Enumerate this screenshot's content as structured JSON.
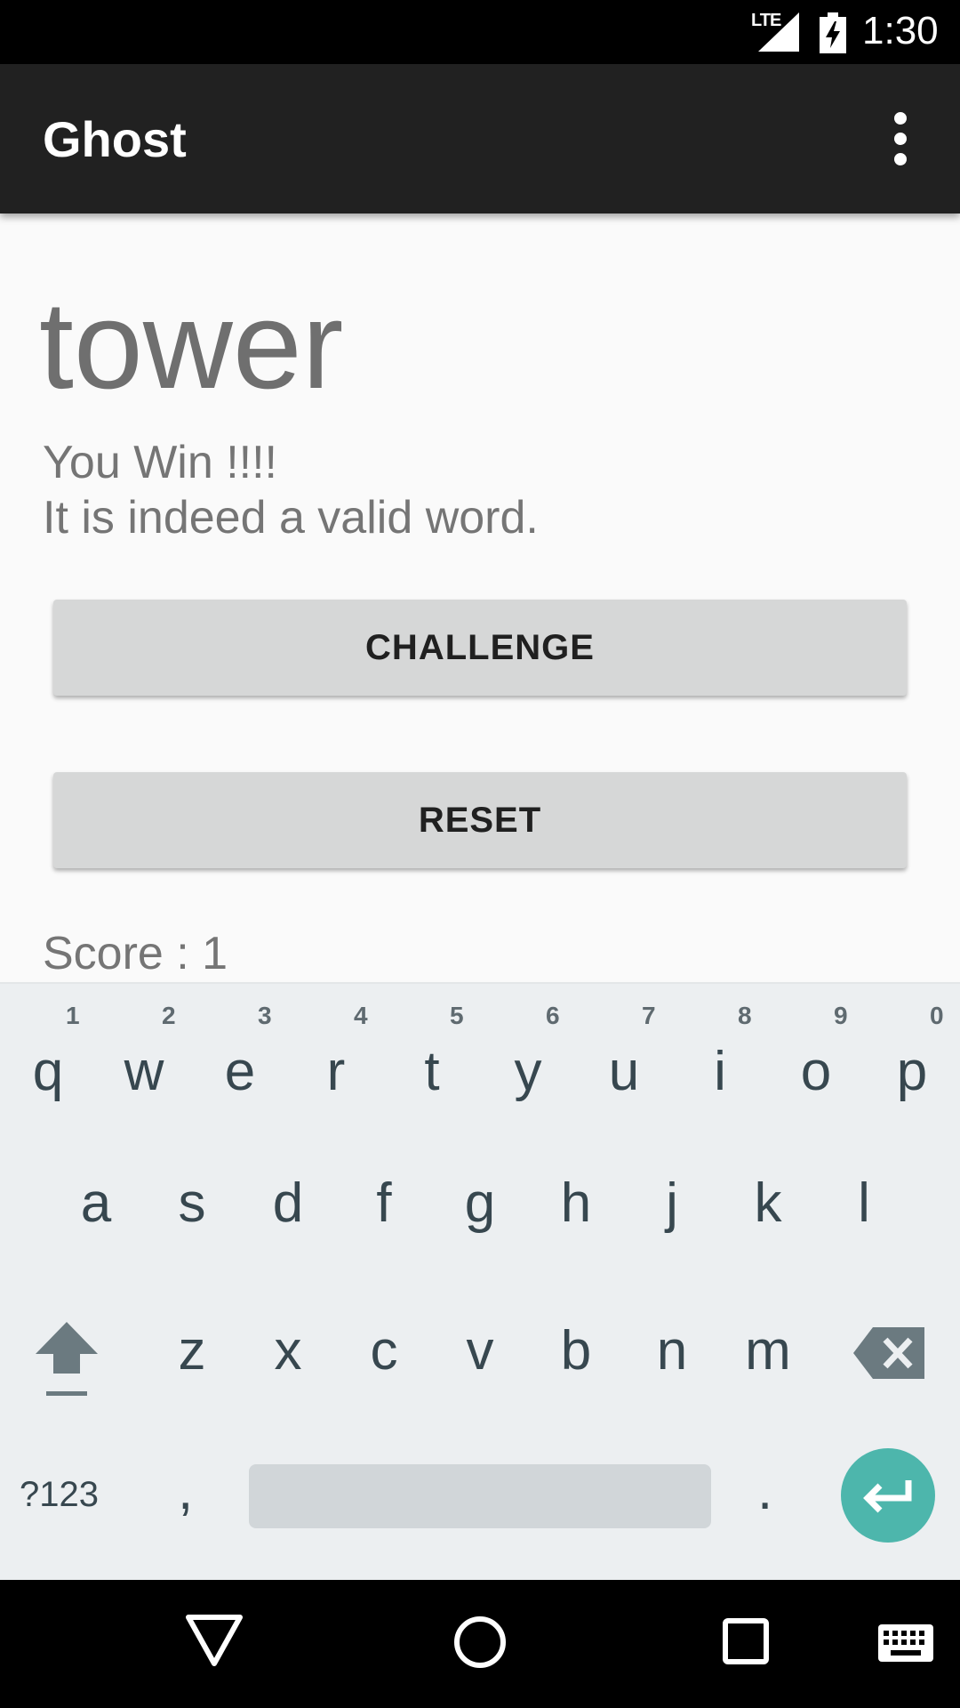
{
  "status_bar": {
    "network": "LTE",
    "time": "1:30"
  },
  "app_bar": {
    "title": "Ghost"
  },
  "main": {
    "word": "tower",
    "message_line1": "You Win !!!!",
    "message_line2": "It is indeed a valid word.",
    "challenge_label": "CHALLENGE",
    "reset_label": "RESET",
    "score_text": "Score : 1"
  },
  "keyboard": {
    "row1": [
      {
        "ch": "q",
        "num": "1"
      },
      {
        "ch": "w",
        "num": "2"
      },
      {
        "ch": "e",
        "num": "3"
      },
      {
        "ch": "r",
        "num": "4"
      },
      {
        "ch": "t",
        "num": "5"
      },
      {
        "ch": "y",
        "num": "6"
      },
      {
        "ch": "u",
        "num": "7"
      },
      {
        "ch": "i",
        "num": "8"
      },
      {
        "ch": "o",
        "num": "9"
      },
      {
        "ch": "p",
        "num": "0"
      }
    ],
    "row2": [
      {
        "ch": "a"
      },
      {
        "ch": "s"
      },
      {
        "ch": "d"
      },
      {
        "ch": "f"
      },
      {
        "ch": "g"
      },
      {
        "ch": "h"
      },
      {
        "ch": "j"
      },
      {
        "ch": "k"
      },
      {
        "ch": "l"
      }
    ],
    "row3": [
      {
        "ch": "z"
      },
      {
        "ch": "x"
      },
      {
        "ch": "c"
      },
      {
        "ch": "v"
      },
      {
        "ch": "b"
      },
      {
        "ch": "n"
      },
      {
        "ch": "m"
      }
    ],
    "symbols_label": "?123",
    "comma": ",",
    "period": ".",
    "enter_color": "#4db6ac"
  },
  "icons": {
    "signal": "signal-icon",
    "battery": "battery-charging-icon",
    "overflow": "more-vert-icon",
    "shift": "shift-icon",
    "backspace": "backspace-icon",
    "enter": "enter-icon",
    "back": "nav-back-icon",
    "home": "nav-home-icon",
    "recents": "nav-recents-icon",
    "keyboard": "keyboard-icon"
  }
}
